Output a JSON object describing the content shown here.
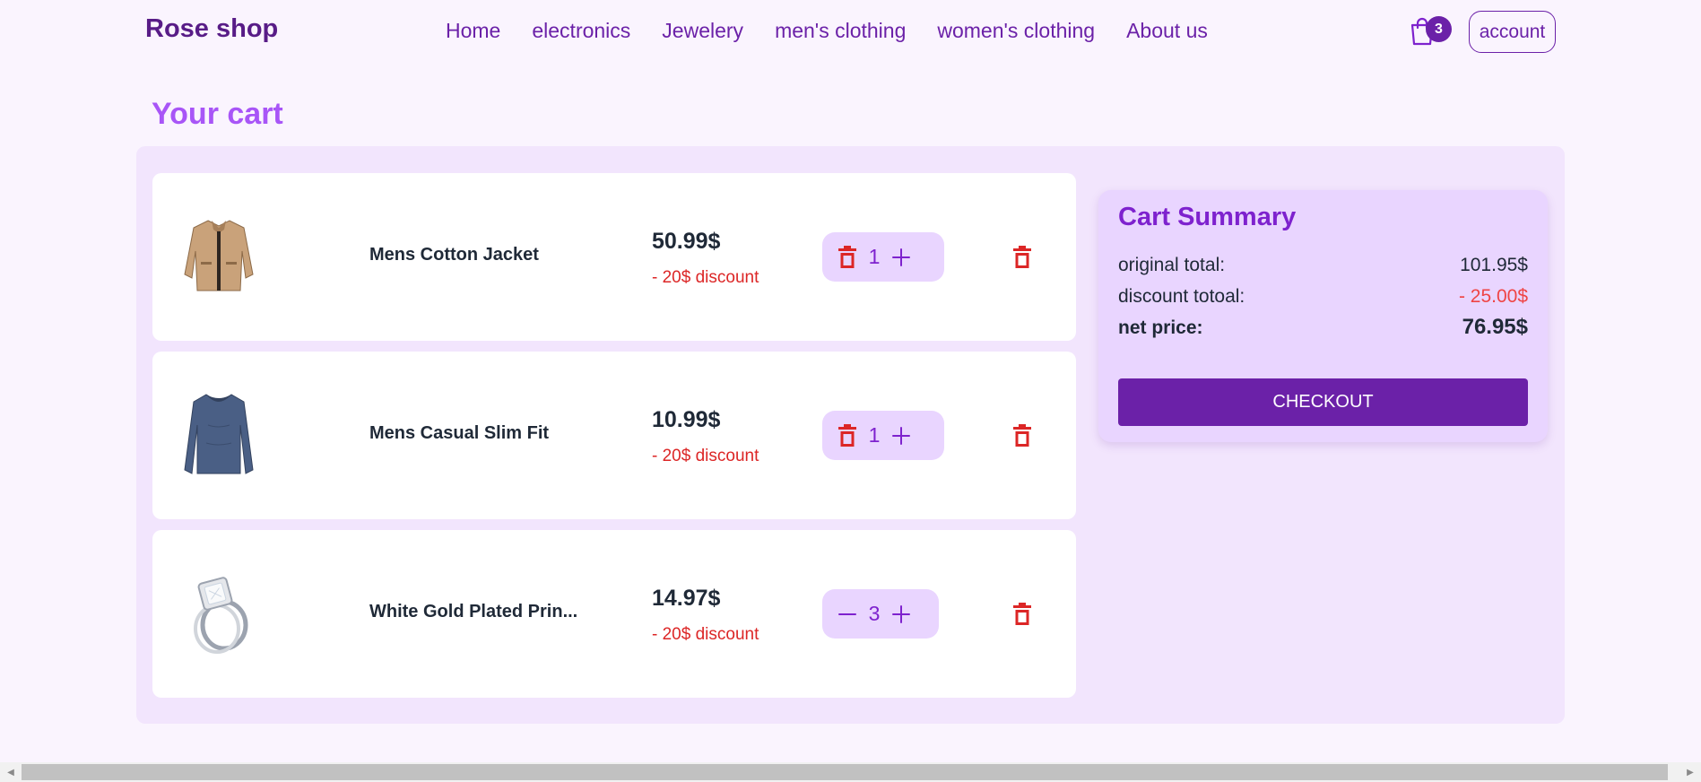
{
  "navbar": {
    "brand": "Rose shop",
    "links": [
      {
        "label": "Home"
      },
      {
        "label": "electronics"
      },
      {
        "label": "Jewelery"
      },
      {
        "label": "men's clothing"
      },
      {
        "label": "women's clothing"
      },
      {
        "label": "About us"
      }
    ],
    "cart_count": "3",
    "cart_icon": "shopping-bag-icon",
    "account_label": "account"
  },
  "page": {
    "title": "Your cart"
  },
  "cart": {
    "items": [
      {
        "name": "Mens Cotton Jacket",
        "price": "50.99$",
        "discount": "- 20$ discount",
        "quantity": "1",
        "image": "jacket-image",
        "decrease_icon": "trash-icon"
      },
      {
        "name": "Mens Casual Slim Fit",
        "price": "10.99$",
        "discount": "- 20$ discount",
        "quantity": "1",
        "image": "shirt-image",
        "decrease_icon": "trash-icon"
      },
      {
        "name": "White Gold Plated Prin...",
        "price": "14.97$",
        "discount": "- 20$ discount",
        "quantity": "3",
        "image": "ring-image",
        "decrease_icon": "minus-icon"
      }
    ]
  },
  "summary": {
    "title": "Cart Summary",
    "original_label": "original total:",
    "original_value": "101.95$",
    "discount_label": "discount totoal:",
    "discount_value": "- 25.00$",
    "net_label": "net price:",
    "net_value": "76.95$",
    "checkout_label": "CHECKOUT"
  },
  "colors": {
    "brand": "#581c87",
    "accent": "#6b21a8",
    "title": "#a855f7",
    "discount": "#dc2626",
    "panel": "#f2e5fd",
    "summary_bg": "#e9d5ff"
  }
}
